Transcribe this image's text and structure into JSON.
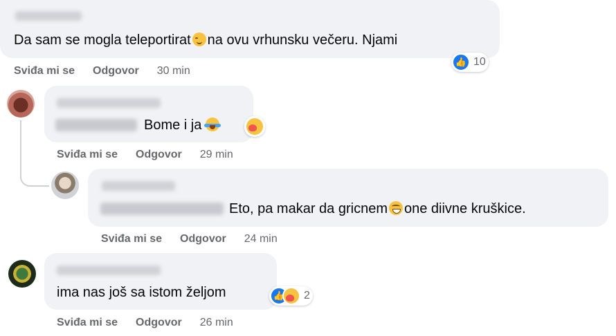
{
  "comments": [
    {
      "text": "Da sam se mogla teleportirat",
      "text_after": "na ovu vrhunsku večeru. Njami",
      "inline_emoji": "relieved-face-icon",
      "reaction_count": "10",
      "reactions": [
        "like-icon"
      ],
      "actions": {
        "like": "Sviđa mi se",
        "reply": "Odgovor",
        "time": "30 min"
      }
    },
    {
      "text": "Bome i ja",
      "inline_emoji": "face-with-tears-of-joy-icon",
      "reactions": [
        "care-icon"
      ],
      "actions": {
        "like": "Sviđa mi se",
        "reply": "Odgovor",
        "time": "29 min"
      }
    },
    {
      "text": "Eto, pa makar da gricnem",
      "text_after": "one diivne kruškice.",
      "inline_emoji": "grinning-face-icon",
      "actions": {
        "like": "Sviđa mi se",
        "reply": "Odgovor",
        "time": "24 min"
      }
    },
    {
      "text": "ima nas još sa istom željom",
      "reaction_count": "2",
      "reactions": [
        "like-icon",
        "care-icon"
      ],
      "actions": {
        "like": "Sviđa mi se",
        "reply": "Odgovor",
        "time": "26 min"
      }
    }
  ],
  "colors": {
    "bubble": "#f0f2f5",
    "meta": "#65676b",
    "like": "#1877f2",
    "text": "#050505"
  }
}
